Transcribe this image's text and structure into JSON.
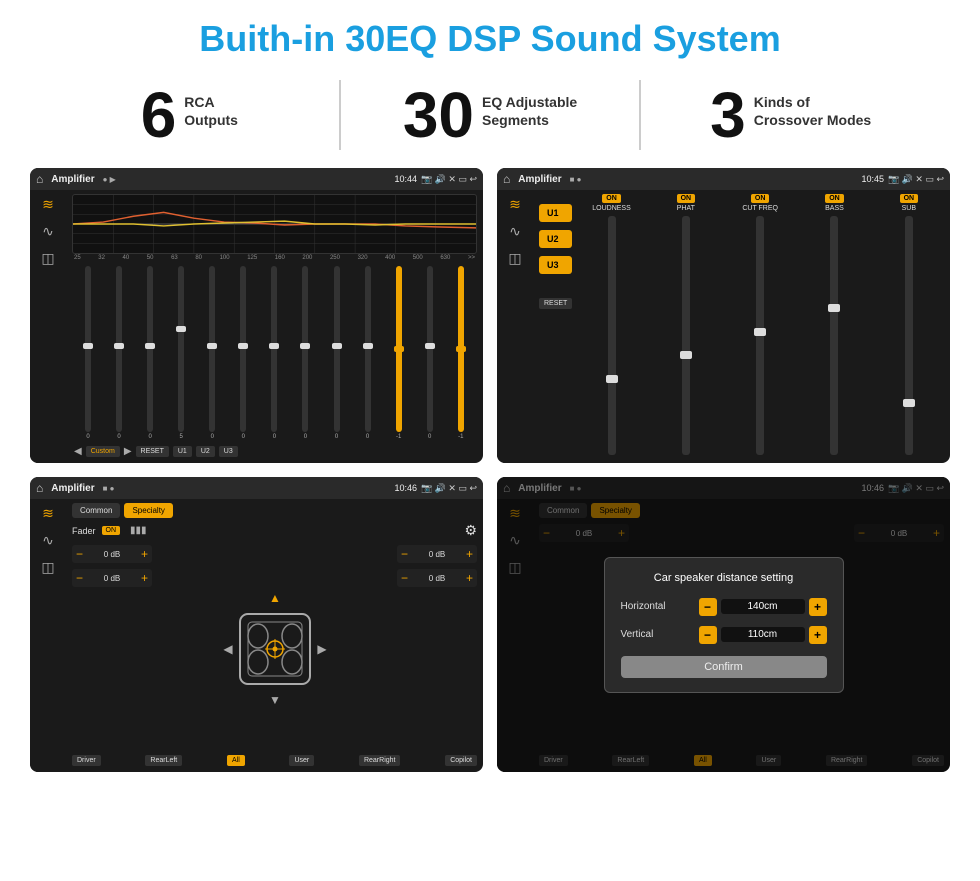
{
  "page": {
    "title": "Buith-in 30EQ DSP Sound System"
  },
  "stats": [
    {
      "number": "6",
      "desc_line1": "RCA",
      "desc_line2": "Outputs"
    },
    {
      "number": "30",
      "desc_line1": "EQ Adjustable",
      "desc_line2": "Segments"
    },
    {
      "number": "3",
      "desc_line1": "Kinds of",
      "desc_line2": "Crossover Modes"
    }
  ],
  "screens": {
    "screen1": {
      "statusbar": {
        "title": "Amplifier",
        "time": "10:44"
      },
      "freqs": [
        "25",
        "32",
        "40",
        "50",
        "63",
        "80",
        "100",
        "125",
        "160",
        "200",
        "250",
        "320",
        "400",
        "500",
        "630"
      ],
      "values": [
        "0",
        "0",
        "0",
        "5",
        "0",
        "0",
        "0",
        "0",
        "0",
        "0",
        "-1",
        "0",
        "-1"
      ],
      "buttons": [
        "Custom",
        "RESET",
        "U1",
        "U2",
        "U3"
      ]
    },
    "screen2": {
      "statusbar": {
        "title": "Amplifier",
        "time": "10:45"
      },
      "units": [
        "U1",
        "U2",
        "U3"
      ],
      "columns": [
        {
          "label": "LOUDNESS",
          "on": true
        },
        {
          "label": "PHAT",
          "on": true
        },
        {
          "label": "CUT FREQ",
          "on": true
        },
        {
          "label": "BASS",
          "on": true
        },
        {
          "label": "SUB",
          "on": true
        }
      ],
      "reset_label": "RESET"
    },
    "screen3": {
      "statusbar": {
        "title": "Amplifier",
        "time": "10:46"
      },
      "tabs": [
        "Common",
        "Specialty"
      ],
      "active_tab": "Specialty",
      "fader_label": "Fader",
      "fader_on": "ON",
      "db_controls": [
        "0 dB",
        "0 dB",
        "0 dB",
        "0 dB"
      ],
      "bottom_buttons": [
        "Driver",
        "RearLeft",
        "All",
        "User",
        "RearRight",
        "Copilot"
      ]
    },
    "screen4": {
      "statusbar": {
        "title": "Amplifier",
        "time": "10:46"
      },
      "tabs": [
        "Common",
        "Specialty"
      ],
      "dialog": {
        "title": "Car speaker distance setting",
        "horizontal_label": "Horizontal",
        "horizontal_value": "140cm",
        "vertical_label": "Vertical",
        "vertical_value": "110cm",
        "confirm_label": "Confirm"
      },
      "db_controls": [
        "0 dB",
        "0 dB"
      ],
      "bottom_buttons": [
        "Driver",
        "RearLeft",
        "All",
        "User",
        "RearRight",
        "Copilot"
      ]
    }
  }
}
